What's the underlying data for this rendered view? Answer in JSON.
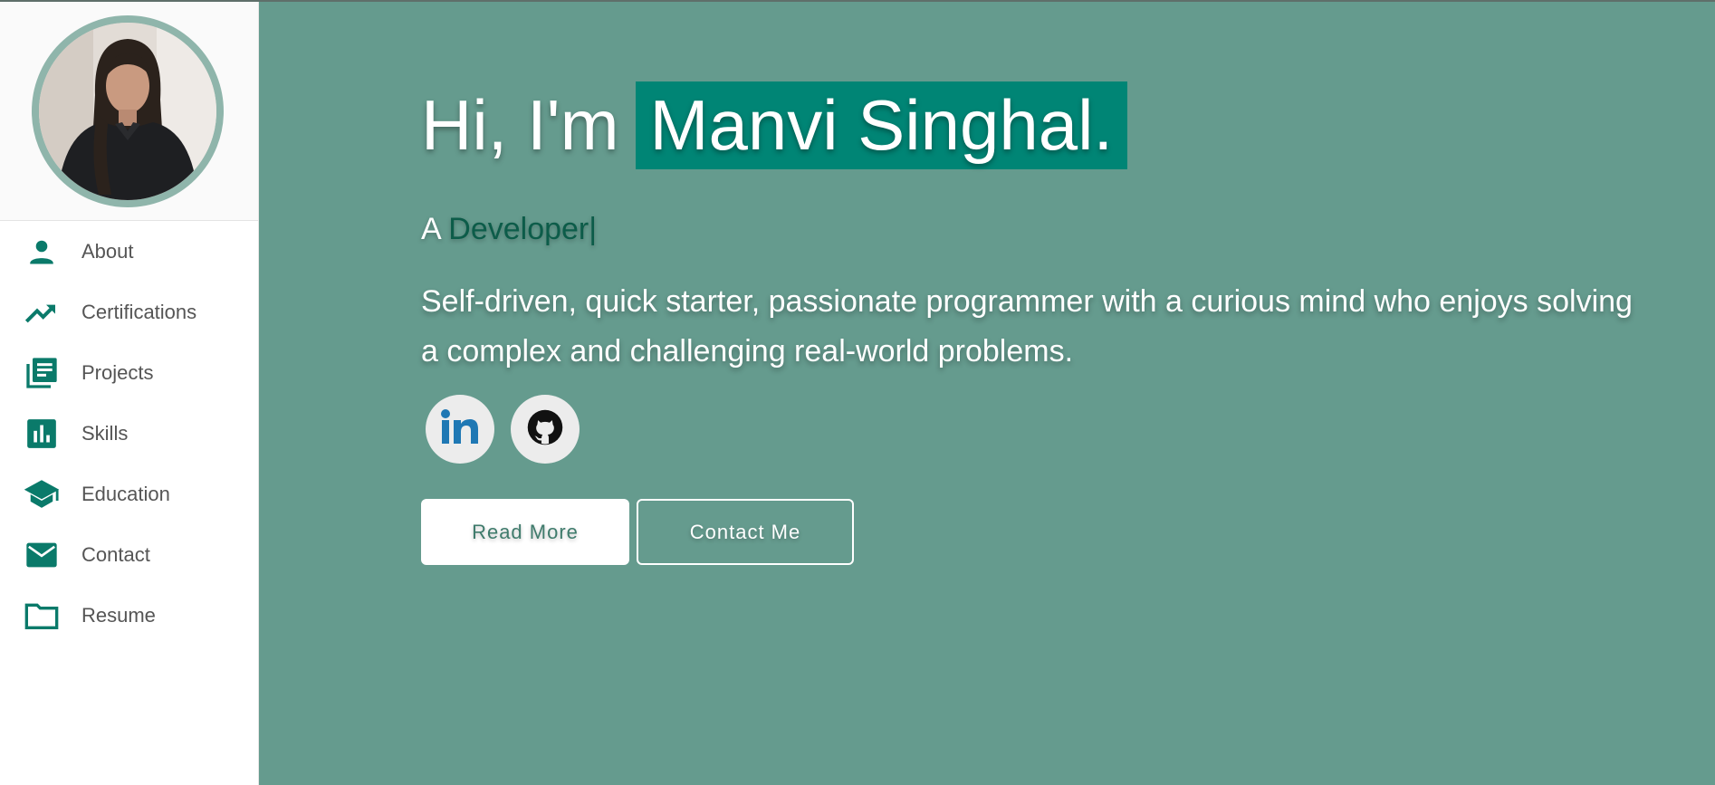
{
  "sidebar": {
    "profile": {
      "alt": "Profile photo"
    },
    "items": [
      {
        "label": "About",
        "icon": "person-icon"
      },
      {
        "label": "Certifications",
        "icon": "trending-up-icon"
      },
      {
        "label": "Projects",
        "icon": "library-books-icon"
      },
      {
        "label": "Skills",
        "icon": "bar-chart-icon"
      },
      {
        "label": "Education",
        "icon": "school-icon"
      },
      {
        "label": "Contact",
        "icon": "mail-icon"
      },
      {
        "label": "Resume",
        "icon": "folder-icon"
      }
    ]
  },
  "hero": {
    "greeting_prefix": "Hi, I'm",
    "name": "Manvi Singhal.",
    "role_prefix": "A",
    "role_word": "Developer|",
    "bio": "Self-driven, quick starter, passionate programmer with a curious mind who enjoys solving a complex and challenging real-world problems."
  },
  "social": [
    {
      "icon": "linkedin-icon"
    },
    {
      "icon": "github-icon"
    }
  ],
  "buttons": {
    "read_more": "Read More",
    "contact_me": "Contact Me"
  },
  "colors": {
    "accent": "#008575",
    "background": "#659b8e",
    "sidebar_icon": "#0a7a6a"
  }
}
